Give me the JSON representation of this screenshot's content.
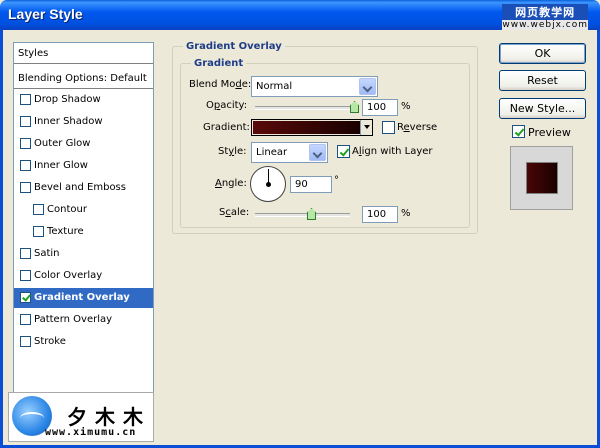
{
  "window": {
    "title": "Layer Style",
    "watermark_top": "网页教学网",
    "watermark_bottom": "www.webjx.com"
  },
  "styles_list": {
    "header": "Styles",
    "blending_options": "Blending Options: Default",
    "items": [
      {
        "label": "Drop Shadow",
        "checked": false
      },
      {
        "label": "Inner Shadow",
        "checked": false
      },
      {
        "label": "Outer Glow",
        "checked": false
      },
      {
        "label": "Inner Glow",
        "checked": false
      },
      {
        "label": "Bevel and Emboss",
        "checked": false
      },
      {
        "label": "Contour",
        "checked": false
      },
      {
        "label": "Texture",
        "checked": false
      },
      {
        "label": "Satin",
        "checked": false
      },
      {
        "label": "Color Overlay",
        "checked": false
      },
      {
        "label": "Gradient Overlay",
        "checked": true,
        "selected": true
      },
      {
        "label": "Pattern Overlay",
        "checked": false
      },
      {
        "label": "Stroke",
        "checked": false
      }
    ]
  },
  "logo": {
    "brand": "夕木木",
    "url": "www.ximumu.cn"
  },
  "panel": {
    "group_title": "Gradient Overlay",
    "subgroup_title": "Gradient",
    "blend_mode_label_pre": "Blend Mo",
    "blend_mode_label_key": "d",
    "blend_mode_label_post": "e:",
    "blend_mode_value": "Normal",
    "opacity_label_pre": "O",
    "opacity_label_key": "p",
    "opacity_label_post": "acity:",
    "opacity_value": "100",
    "opacity_unit": "%",
    "opacity_fraction": 1.0,
    "gradient_label": "Gradient:",
    "reverse_label_pre": "R",
    "reverse_label_key": "e",
    "reverse_label_post": "verse",
    "reverse_checked": false,
    "style_label_pre": "St",
    "style_label_key": "y",
    "style_label_post": "le:",
    "style_value": "Linear",
    "align_label_pre": "A",
    "align_label_key": "l",
    "align_label_post": "ign with Layer",
    "align_checked": true,
    "angle_label_pre": "",
    "angle_label_key": "A",
    "angle_label_post": "ngle:",
    "angle_value": "90",
    "angle_unit": "°",
    "scale_label_pre": "S",
    "scale_label_key": "c",
    "scale_label_post": "ale:",
    "scale_value": "100",
    "scale_unit": "%",
    "scale_fraction": 0.6
  },
  "buttons": {
    "ok": "OK",
    "reset": "Reset",
    "new_style": "New Style...",
    "preview": "Preview",
    "preview_checked": true
  },
  "colors": {
    "gradient_start": "#5a0a0a",
    "gradient_end": "#190000",
    "selection": "#316ac5",
    "title_blue": "#0058ee"
  }
}
